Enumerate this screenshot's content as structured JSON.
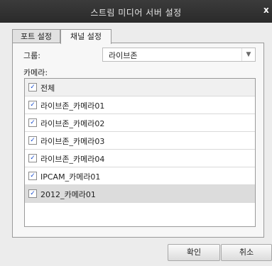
{
  "window": {
    "title": "스트림 미디어 서버 설정",
    "close_glyph": "x"
  },
  "tabs": [
    {
      "label": "포트 설정"
    },
    {
      "label": "채널 설정"
    }
  ],
  "form": {
    "group_label": "그룹:",
    "group_value": "라이브존",
    "camera_label": "카메라:"
  },
  "camera_list": [
    {
      "label": "전체",
      "checked": true
    },
    {
      "label": "라이브존_카메라01",
      "checked": true
    },
    {
      "label": "라이브존_카메라02",
      "checked": true
    },
    {
      "label": "라이브존_카메라03",
      "checked": true
    },
    {
      "label": "라이브존_카메라04",
      "checked": true
    },
    {
      "label": "IPCAM_카메라01",
      "checked": true
    },
    {
      "label": "2012_카메라01",
      "checked": true
    }
  ],
  "buttons": {
    "ok": "확인",
    "cancel": "취소"
  }
}
